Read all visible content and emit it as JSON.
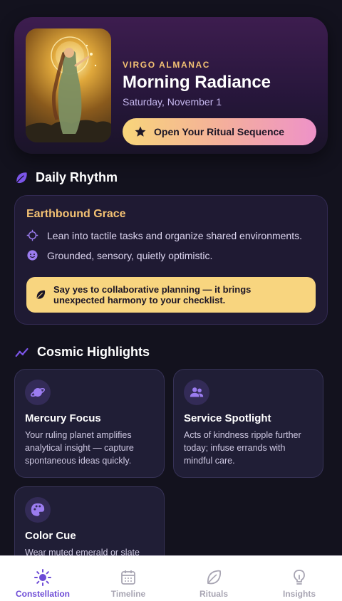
{
  "hero": {
    "eyebrow": "VIRGO ALMANAC",
    "title": "Morning Radiance",
    "date": "Saturday, November 1",
    "button_label": "Open Your Ritual Sequence"
  },
  "daily_rhythm": {
    "heading": "Daily Rhythm",
    "title": "Earthbound Grace",
    "focus": "Lean into tactile tasks and organize shared environments.",
    "mood": "Grounded, sensory, quietly optimistic.",
    "tip": "Say yes to collaborative planning — it brings unexpected harmony to your checklist."
  },
  "highlights": {
    "heading": "Cosmic Highlights",
    "cards": [
      {
        "title": "Mercury Focus",
        "body": "Your ruling planet amplifies analytical insight — capture spontaneous ideas quickly.",
        "icon": "planet-icon"
      },
      {
        "title": "Service Spotlight",
        "body": "Acts of kindness ripple further today; infuse errands with mindful care.",
        "icon": "people-icon"
      },
      {
        "title": "Color Cue",
        "body": "Wear muted emerald or slate",
        "icon": "palette-icon"
      }
    ]
  },
  "tabs": [
    {
      "label": "Constellation",
      "icon": "sun-icon",
      "active": true
    },
    {
      "label": "Timeline",
      "icon": "calendar-icon",
      "active": false
    },
    {
      "label": "Rituals",
      "icon": "leaf-icon",
      "active": false
    },
    {
      "label": "Insights",
      "icon": "lightbulb-icon",
      "active": false
    }
  ],
  "colors": {
    "background": "#13121e",
    "accent_gold": "#f3c173",
    "accent_purple": "#6d4bd6",
    "card": "#1f1a33"
  }
}
